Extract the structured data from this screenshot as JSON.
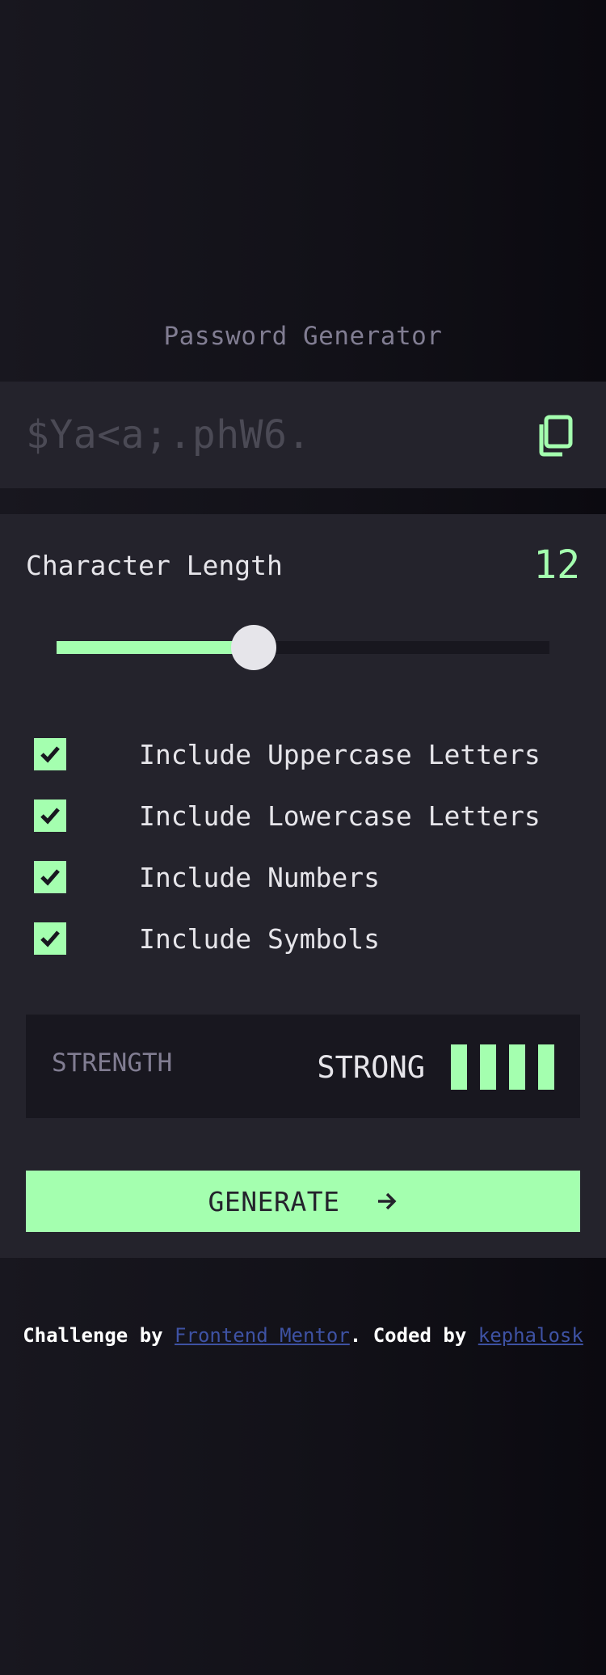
{
  "app": {
    "title": "Password Generator"
  },
  "password": {
    "value": "$Ya<a;.phW6.",
    "copy_icon": "copy-icon"
  },
  "length": {
    "label": "Character Length",
    "value": "12",
    "min": 0,
    "max": 25,
    "slider_fraction": 0.4
  },
  "options": [
    {
      "label": "Include Uppercase Letters",
      "checked": true
    },
    {
      "label": "Include Lowercase Letters",
      "checked": true
    },
    {
      "label": "Include Numbers",
      "checked": true
    },
    {
      "label": "Include Symbols",
      "checked": true
    }
  ],
  "strength": {
    "label": "STRENGTH",
    "value": "STRONG",
    "level": 4,
    "max_level": 4
  },
  "generate": {
    "label": "GENERATE",
    "icon": "arrow-right-icon"
  },
  "footer": {
    "prefix": "Challenge by ",
    "link1": "Frontend Mentor",
    "middle": ". Coded by ",
    "link2": "kephalosk"
  },
  "colors": {
    "accent": "#a4ffaf",
    "panel": "#24232c",
    "muted": "#817d92",
    "dark": "#18171f",
    "link": "#3e52a3"
  }
}
